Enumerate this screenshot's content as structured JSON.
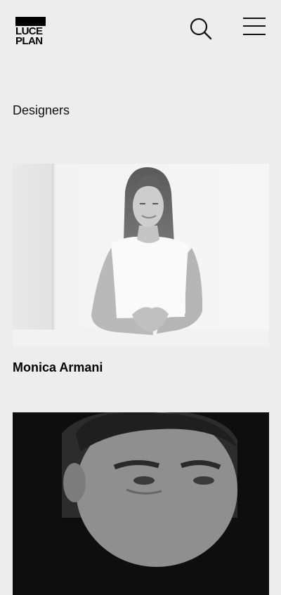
{
  "brand": {
    "logo_line1": "LUCE",
    "logo_line2": "PLAN"
  },
  "header": {
    "search_icon": "search-icon",
    "menu_icon": "hamburger-menu-icon"
  },
  "section": {
    "title": "Designers"
  },
  "designers": [
    {
      "name": "Monica Armani",
      "image": "portrait-photo"
    },
    {
      "name": "",
      "image": "portrait-photo"
    }
  ],
  "colors": {
    "background": "#ededed",
    "text": "#111111",
    "logo": "#000000"
  }
}
